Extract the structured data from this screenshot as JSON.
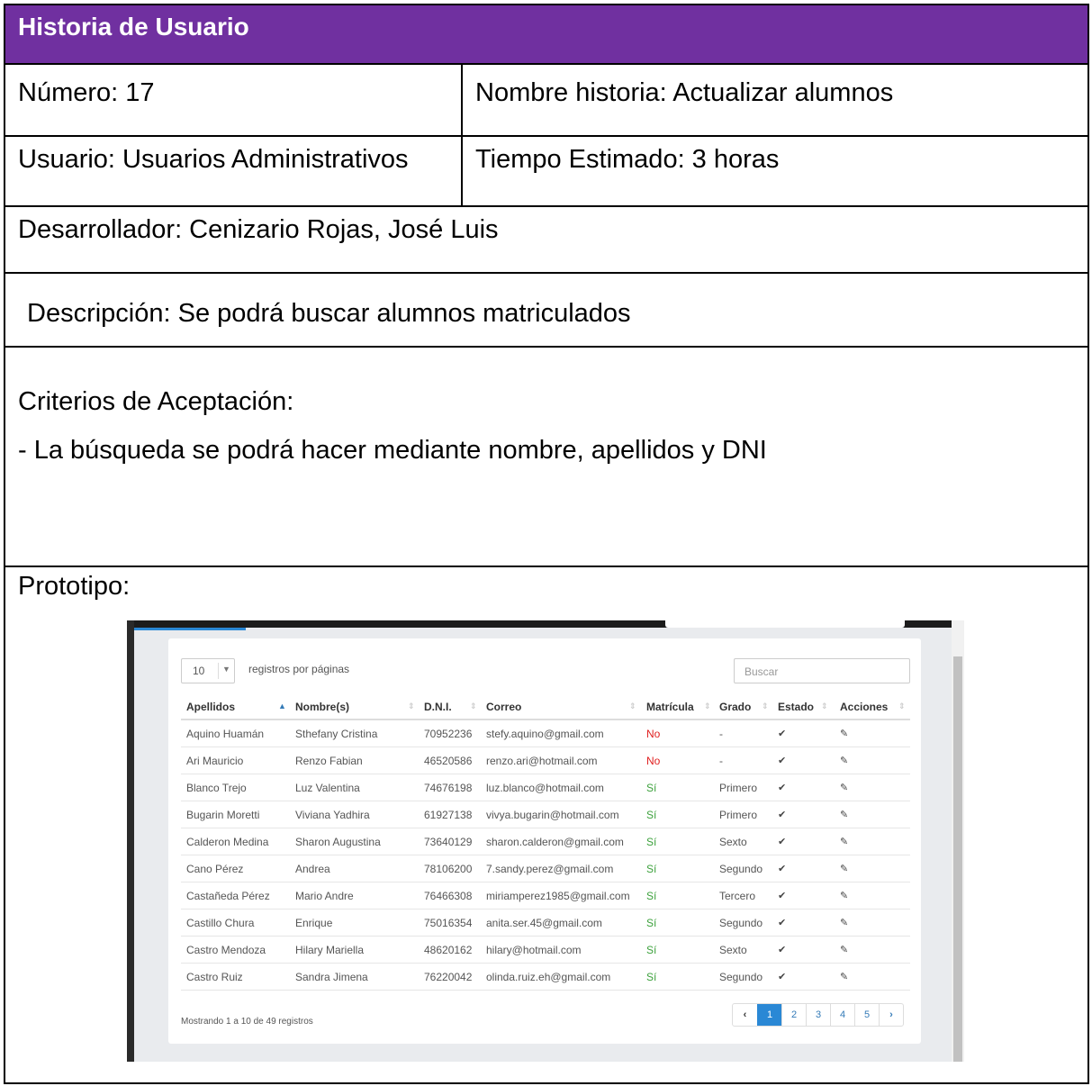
{
  "header": {
    "title": "Historia de Usuario"
  },
  "fields": {
    "numero": "Número: 17",
    "nombre_historia": "Nombre historia: Actualizar alumnos",
    "usuario": "Usuario: Usuarios Administrativos",
    "tiempo": "Tiempo Estimado: 3 horas",
    "desarrollador": "Desarrollador:   Cenizario Rojas, José Luis",
    "descripcion": "Descripción: Se podrá buscar alumnos matriculados",
    "criterios_title": "Criterios de Aceptación:",
    "criterios_item": "-  La búsqueda se podrá hacer mediante nombre, apellidos y DNI",
    "prototipo": "Prototipo:"
  },
  "prototype": {
    "page_length": "10",
    "page_length_label": "registros por páginas",
    "search_placeholder": "Buscar",
    "columns": [
      "Apellidos",
      "Nombre(s)",
      "D.N.I.",
      "Correo",
      "Matrícula",
      "Grado",
      "Estado",
      "Acciones"
    ],
    "rows": [
      {
        "apellidos": "Aquino Huamán",
        "nombres": "Sthefany Cristina",
        "dni": "70952236",
        "correo": "stefy.aquino@gmail.com",
        "matricula": "No",
        "grado": "-",
        "estado": "✔",
        "acciones": "✎"
      },
      {
        "apellidos": "Ari Mauricio",
        "nombres": "Renzo Fabian",
        "dni": "46520586",
        "correo": "renzo.ari@hotmail.com",
        "matricula": "No",
        "grado": "-",
        "estado": "✔",
        "acciones": "✎"
      },
      {
        "apellidos": "Blanco Trejo",
        "nombres": "Luz Valentina",
        "dni": "74676198",
        "correo": "luz.blanco@hotmail.com",
        "matricula": "Sí",
        "grado": "Primero",
        "estado": "✔",
        "acciones": "✎"
      },
      {
        "apellidos": "Bugarin Moretti",
        "nombres": "Viviana Yadhira",
        "dni": "61927138",
        "correo": "vivya.bugarin@hotmail.com",
        "matricula": "Sí",
        "grado": "Primero",
        "estado": "✔",
        "acciones": "✎"
      },
      {
        "apellidos": "Calderon Medina",
        "nombres": "Sharon Augustina",
        "dni": "73640129",
        "correo": "sharon.calderon@gmail.com",
        "matricula": "Sí",
        "grado": "Sexto",
        "estado": "✔",
        "acciones": "✎"
      },
      {
        "apellidos": "Cano Pérez",
        "nombres": "Andrea",
        "dni": "78106200",
        "correo": "7.sandy.perez@gmail.com",
        "matricula": "Sí",
        "grado": "Segundo",
        "estado": "✔",
        "acciones": "✎"
      },
      {
        "apellidos": "Castañeda Pérez",
        "nombres": "Mario Andre",
        "dni": "76466308",
        "correo": "miriamperez1985@gmail.com",
        "matricula": "Sí",
        "grado": "Tercero",
        "estado": "✔",
        "acciones": "✎"
      },
      {
        "apellidos": "Castillo Chura",
        "nombres": "Enrique",
        "dni": "75016354",
        "correo": "anita.ser.45@gmail.com",
        "matricula": "Sí",
        "grado": "Segundo",
        "estado": "✔",
        "acciones": "✎"
      },
      {
        "apellidos": "Castro Mendoza",
        "nombres": "Hilary Mariella",
        "dni": "48620162",
        "correo": "hilary@hotmail.com",
        "matricula": "Sí",
        "grado": "Sexto",
        "estado": "✔",
        "acciones": "✎"
      },
      {
        "apellidos": "Castro Ruiz",
        "nombres": "Sandra Jimena",
        "dni": "76220042",
        "correo": "olinda.ruiz.eh@gmail.com",
        "matricula": "Sí",
        "grado": "Segundo",
        "estado": "✔",
        "acciones": "✎"
      }
    ],
    "info": "Mostrando 1 a 10 de 49 registros",
    "pagination": {
      "prev": "‹",
      "pages": [
        "1",
        "2",
        "3",
        "4",
        "5"
      ],
      "next": "›",
      "current": "1"
    },
    "colors": {
      "accent": "#2a88d5",
      "no": "#e02020",
      "si": "#3ca13c",
      "header_bg": "#7030a0"
    }
  }
}
